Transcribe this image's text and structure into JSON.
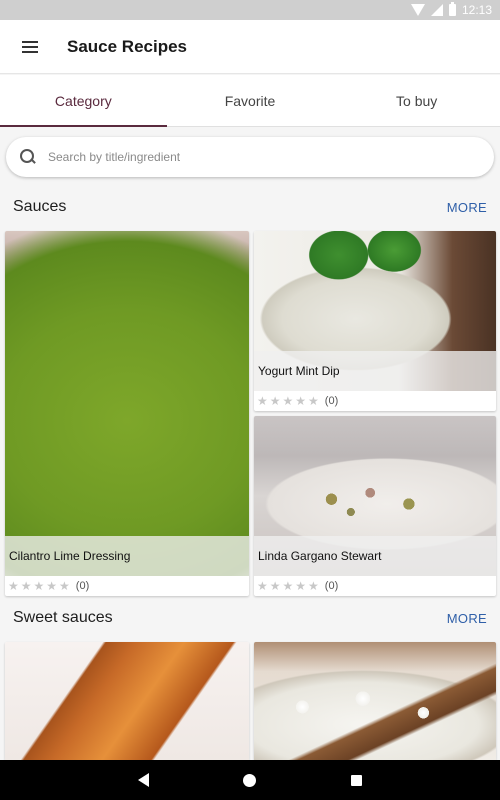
{
  "status_bar": {
    "time": "12:13"
  },
  "app_bar": {
    "title": "Sauce Recipes"
  },
  "tabs": [
    {
      "label": "Category",
      "active": true
    },
    {
      "label": "Favorite",
      "active": false
    },
    {
      "label": "To buy",
      "active": false
    }
  ],
  "search": {
    "placeholder": "Search by title/ingredient",
    "value": ""
  },
  "sections": [
    {
      "title": "Sauces",
      "more_label": "MORE",
      "cards": [
        {
          "title": "Cilantro Lime Dressing",
          "rating_count": "(0)",
          "stars": "★★★★★"
        },
        {
          "title": "Yogurt Mint Dip",
          "rating_count": "(0)",
          "stars": "★★★★★"
        },
        {
          "title": "Linda Gargano Stewart",
          "rating_count": "(0)",
          "stars": "★★★★★"
        }
      ]
    },
    {
      "title": "Sweet sauces",
      "more_label": "MORE"
    }
  ],
  "colors": {
    "accent": "#5a2a3e",
    "link": "#2f5fa8"
  }
}
